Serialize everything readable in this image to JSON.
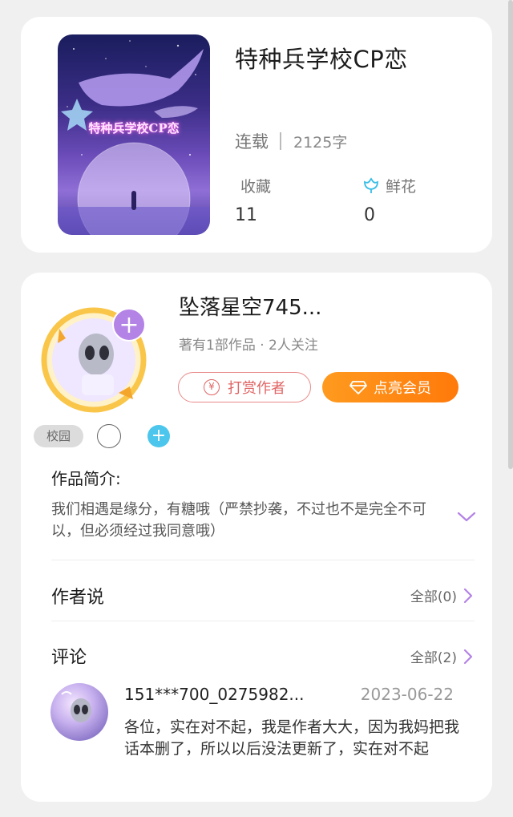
{
  "book": {
    "title": "特种兵学校CP恋",
    "cover_text": "特种兵学校CP恋",
    "status": "连载",
    "word_count": "2125字",
    "favorites_label": "收藏",
    "favorites_count": "11",
    "flowers_label": "鲜花",
    "flowers_count": "0"
  },
  "author": {
    "name": "坠落星空745...",
    "meta": "著有1部作品 · 2人关注",
    "tip_button": "打赏作者",
    "tip_icon_glyph": "¥",
    "vip_button": "点亮会员",
    "follow_glyph": "+",
    "tags": [
      "校园"
    ],
    "add_tag_glyph": "+"
  },
  "intro": {
    "title": "作品简介:",
    "text": "我们相遇是缘分，有糖哦（严禁抄袭，不过也不是完全不可以，但必须经过我同意哦）"
  },
  "author_says": {
    "title": "作者说",
    "link": "全部(0)"
  },
  "comments": {
    "title": "评论",
    "link": "全部(2)",
    "items": [
      {
        "user": "151***700_0275982...",
        "date": "2023-06-22",
        "text": "各位，实在对不起，我是作者大大，因为我妈把我话本删了，所以以后没法更新了，实在对不起"
      }
    ]
  },
  "colors": {
    "accent_purple": "#b483e6",
    "vip_orange": "#ff8a12",
    "tip_red": "#e06464",
    "tag_blue": "#4cc6ec"
  }
}
